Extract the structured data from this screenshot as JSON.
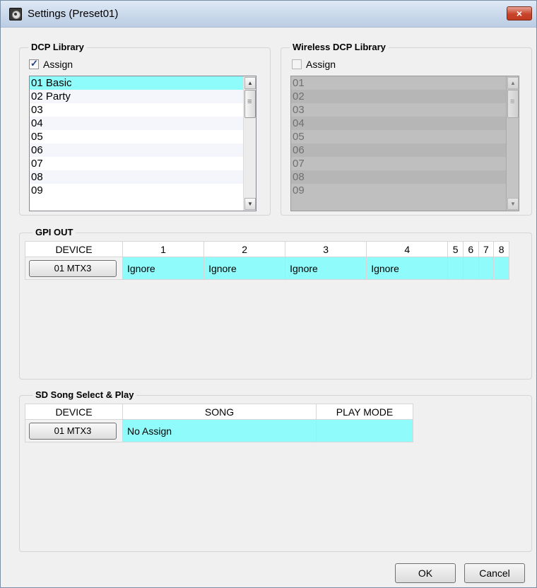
{
  "window": {
    "title": "Settings (Preset01)",
    "close_glyph": "×"
  },
  "dcp_library": {
    "label": "DCP Library",
    "assign_label": "Assign",
    "assign_checked": true,
    "items": [
      "01 Basic",
      "02 Party",
      "03",
      "04",
      "05",
      "06",
      "07",
      "08",
      "09"
    ],
    "selected": "01 Basic"
  },
  "wireless_dcp_library": {
    "label": "Wireless DCP Library",
    "assign_label": "Assign",
    "assign_checked": false,
    "items": [
      "01",
      "02",
      "03",
      "04",
      "05",
      "06",
      "07",
      "08",
      "09"
    ]
  },
  "gpi_out": {
    "label": "GPI OUT",
    "columns": [
      "DEVICE",
      "1",
      "2",
      "3",
      "4",
      "5",
      "6",
      "7",
      "8"
    ],
    "rows": [
      {
        "device": "01 MTX3",
        "values": [
          "Ignore",
          "Ignore",
          "Ignore",
          "Ignore",
          "",
          "",
          "",
          ""
        ]
      }
    ]
  },
  "sd_song": {
    "label": "SD Song Select & Play",
    "columns": [
      "DEVICE",
      "SONG",
      "PLAY MODE"
    ],
    "rows": [
      {
        "device": "01 MTX3",
        "song": "No Assign",
        "play_mode": ""
      }
    ]
  },
  "buttons": {
    "ok": "OK",
    "cancel": "Cancel"
  },
  "colors": {
    "selection": "#8ffcfc",
    "cell_fill": "#90fbfb",
    "title_bar": "#c8d7ea",
    "close_button": "#c7452b"
  }
}
